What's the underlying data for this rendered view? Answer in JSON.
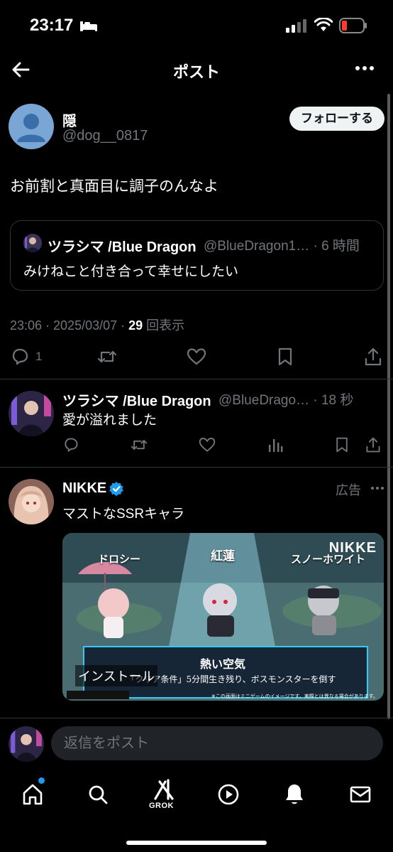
{
  "status_bar": {
    "time": "23:17"
  },
  "nav": {
    "title": "ポスト"
  },
  "post": {
    "author_name": "隠",
    "author_handle": "@dog__0817",
    "follow_label": "フォローする",
    "text": "お前割と真面目に調子のんなよ",
    "timestamp": "23:06 · 2025/03/07 · ",
    "views_count": "29",
    "views_label": " 回表示",
    "reply_count": "1"
  },
  "quote": {
    "name": "ツラシマ /Blue Dragon",
    "handle": "@BlueDragon1… · 6 時間",
    "text": "みけねこと付き合って幸せにしたい"
  },
  "reply": {
    "name": "ツラシマ /Blue Dragon",
    "handle": "@BlueDrago… · 18 秒",
    "text": "愛が溢れました"
  },
  "ad": {
    "name": "NIKKE",
    "label": "広告",
    "text": "マストなSSRキャラ",
    "install_label": "インストール",
    "media_labels": {
      "left": "ドロシー",
      "center": "紅蓮",
      "right": "スノーホワイト",
      "logo": "NIKKE"
    }
  },
  "reply_bar": {
    "placeholder": "返信をポスト"
  },
  "tab_bar": {
    "grok_label": "GROK"
  },
  "colors": {
    "background": "#000000",
    "accent": "#1d9bf0",
    "muted": "#71767b",
    "divider": "#2f3336"
  }
}
